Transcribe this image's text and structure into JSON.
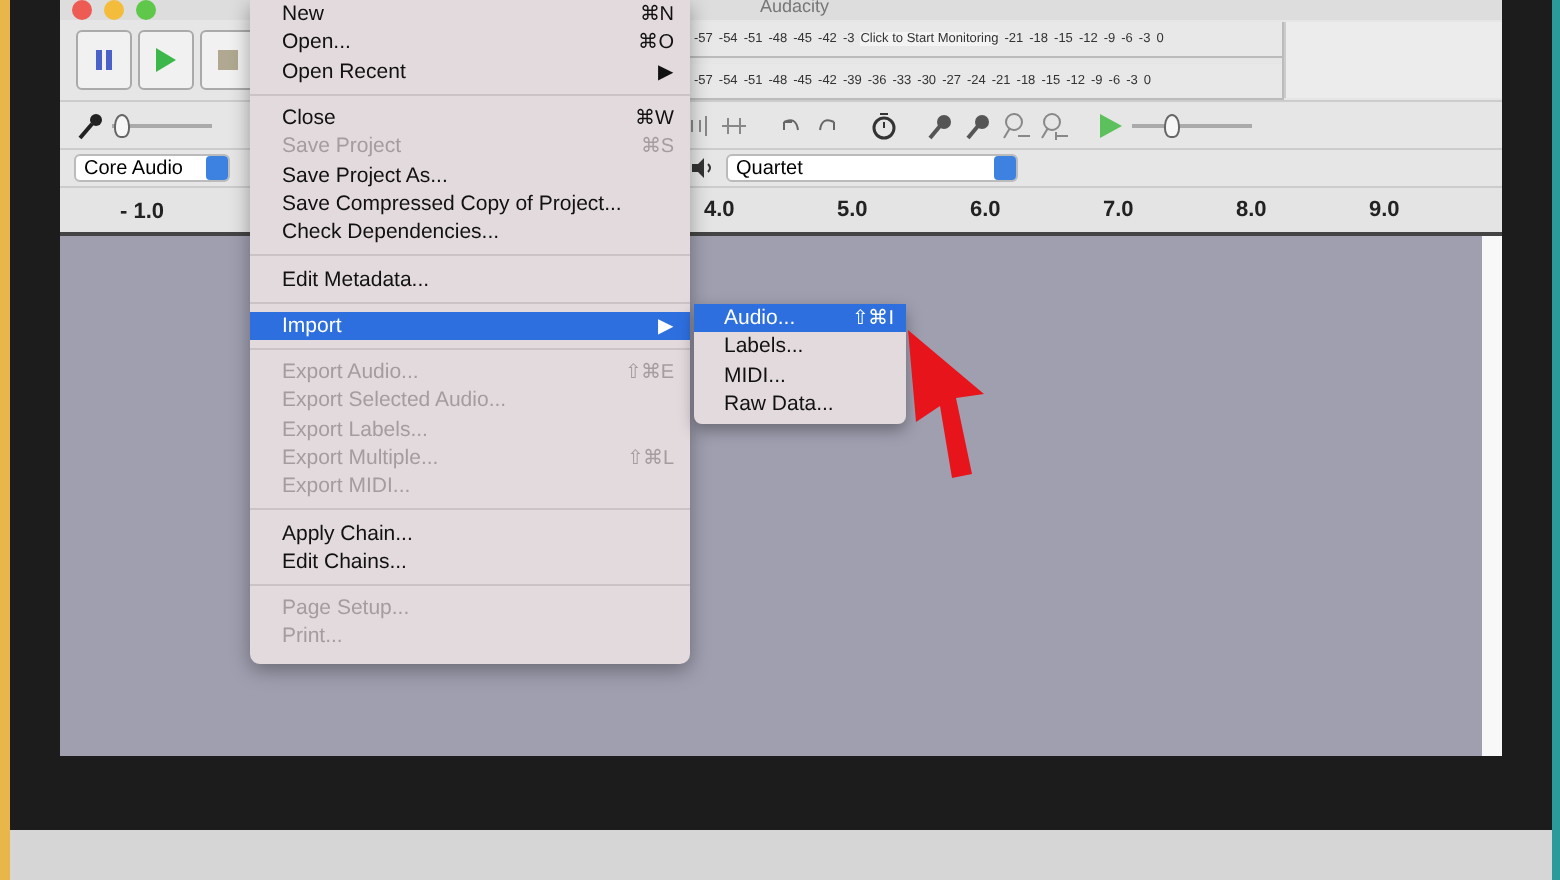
{
  "window": {
    "title": "Audacity"
  },
  "meters": {
    "recording_scale": [
      "-57",
      "-54",
      "-51",
      "-48",
      "-45",
      "-42",
      "-3"
    ],
    "recording_prompt": "Click to Start Monitoring",
    "recording_scale_end": [
      "-21",
      "-18",
      "-15",
      "-12",
      "-9",
      "-6",
      "-3",
      "0"
    ],
    "playback_scale": [
      "-57",
      "-54",
      "-51",
      "-48",
      "-45",
      "-42",
      "-39",
      "-36",
      "-33",
      "-30",
      "-27",
      "-24",
      "-21",
      "-18",
      "-15",
      "-12",
      "-9",
      "-6",
      "-3",
      "0"
    ]
  },
  "mixer": {
    "recording_volume": {
      "level": 0.02
    },
    "play_speed": {
      "level": 0.3
    }
  },
  "devices": {
    "host": "Core Audio",
    "output": "Quartet"
  },
  "ruler": {
    "left_labels": [
      "- 1.0"
    ],
    "right_labels": [
      "4.0",
      "5.0",
      "6.0",
      "7.0",
      "8.0",
      "9.0"
    ]
  },
  "file_menu": [
    {
      "kind": "item",
      "label": "New",
      "shortcut": "⌘N",
      "disabled": false,
      "selected": false
    },
    {
      "kind": "item",
      "label": "Open...",
      "shortcut": "⌘O",
      "disabled": false,
      "selected": false
    },
    {
      "kind": "item",
      "label": "Open Recent",
      "arrow": "▶",
      "disabled": false,
      "selected": false
    },
    {
      "kind": "separator"
    },
    {
      "kind": "item",
      "label": "Close",
      "shortcut": "⌘W",
      "disabled": false,
      "selected": false
    },
    {
      "kind": "item",
      "label": "Save Project",
      "shortcut": "⌘S",
      "disabled": true,
      "selected": false
    },
    {
      "kind": "item",
      "label": "Save Project As...",
      "disabled": false,
      "selected": false
    },
    {
      "kind": "item",
      "label": "Save Compressed Copy of Project...",
      "disabled": false,
      "selected": false
    },
    {
      "kind": "item",
      "label": "Check Dependencies...",
      "disabled": false,
      "selected": false
    },
    {
      "kind": "separator"
    },
    {
      "kind": "item",
      "label": "Edit Metadata...",
      "disabled": false,
      "selected": false
    },
    {
      "kind": "separator"
    },
    {
      "kind": "item",
      "label": "Import",
      "arrow": "▶",
      "disabled": false,
      "selected": true
    },
    {
      "kind": "separator"
    },
    {
      "kind": "item",
      "label": "Export Audio...",
      "shortcut": "⇧⌘E",
      "disabled": true,
      "selected": false
    },
    {
      "kind": "item",
      "label": "Export Selected Audio...",
      "disabled": true,
      "selected": false
    },
    {
      "kind": "item",
      "label": "Export Labels...",
      "disabled": true,
      "selected": false
    },
    {
      "kind": "item",
      "label": "Export Multiple...",
      "shortcut": "⇧⌘L",
      "disabled": true,
      "selected": false
    },
    {
      "kind": "item",
      "label": "Export MIDI...",
      "disabled": true,
      "selected": false
    },
    {
      "kind": "separator"
    },
    {
      "kind": "item",
      "label": "Apply Chain...",
      "disabled": false,
      "selected": false
    },
    {
      "kind": "item",
      "label": "Edit Chains...",
      "disabled": false,
      "selected": false
    },
    {
      "kind": "separator"
    },
    {
      "kind": "item",
      "label": "Page Setup...",
      "disabled": true,
      "selected": false
    },
    {
      "kind": "item",
      "label": "Print...",
      "disabled": true,
      "selected": false
    }
  ],
  "import_submenu": [
    {
      "label": "Audio...",
      "shortcut": "⇧⌘I",
      "selected": true
    },
    {
      "label": "Labels...",
      "selected": false
    },
    {
      "label": "MIDI...",
      "selected": false
    },
    {
      "label": "Raw Data...",
      "selected": false
    }
  ]
}
